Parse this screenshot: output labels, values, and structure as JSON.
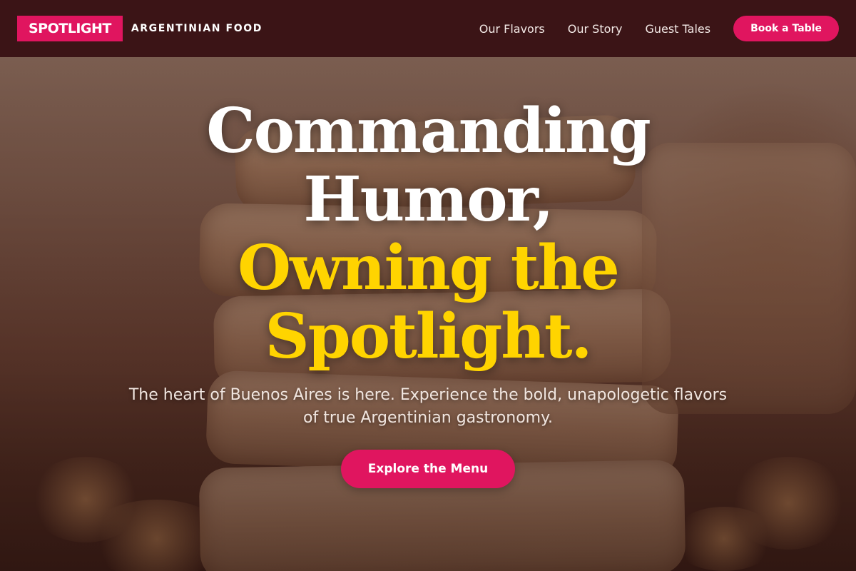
{
  "brand": {
    "name": "SPOTLIGHT",
    "subtitle": "ARGENTINIAN FOOD"
  },
  "nav": {
    "links": [
      "Our Flavors",
      "Our Story",
      "Guest Tales"
    ],
    "cta_label": "Book a Table"
  },
  "hero": {
    "headline_white_1": "Commanding",
    "headline_white_2": "Humor,",
    "headline_yellow_1": "Owning the",
    "headline_yellow_2": "Spotlight.",
    "tagline": "The heart of Buenos Aires is here. Experience the bold, unapologetic flavors of true Argentinian gastronomy.",
    "cta_label": "Explore the Menu"
  },
  "colors": {
    "accent": "#e0155f",
    "header_bg": "#3b1416",
    "headline_highlight": "#ffd400"
  }
}
